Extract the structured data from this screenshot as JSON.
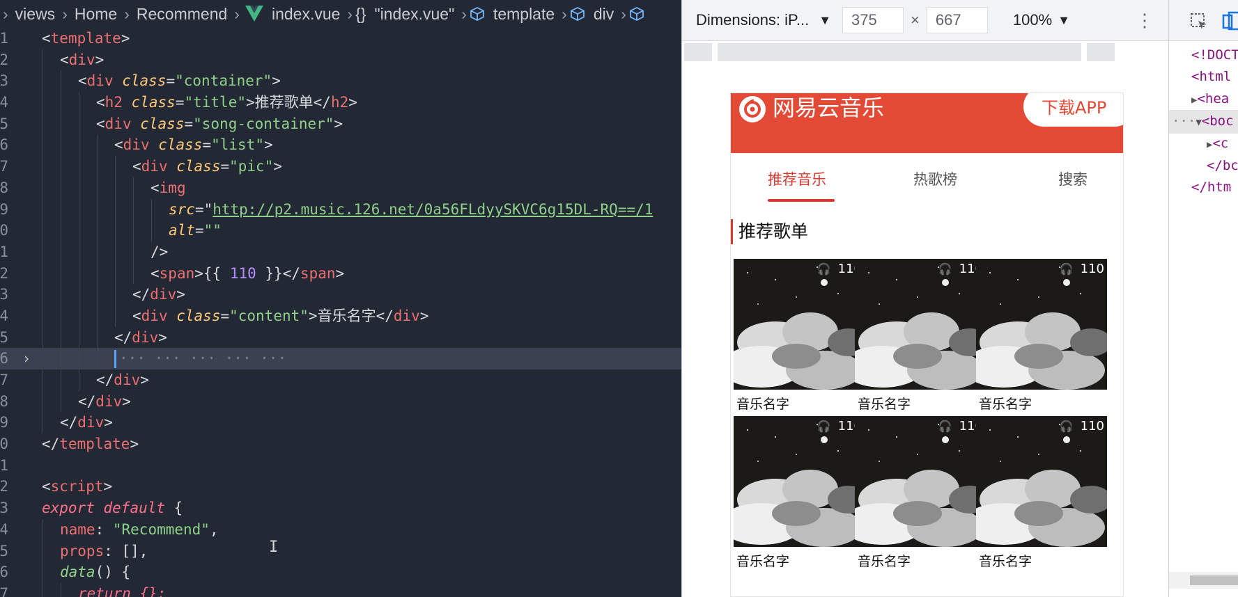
{
  "editor": {
    "breadcrumb": {
      "views": "views",
      "home": "Home",
      "recommend": "Recommend",
      "file": "index.vue",
      "braces": "{}",
      "component": "\"index.vue\"",
      "template": "template",
      "div": "div"
    },
    "line_numbers": [
      "1",
      "2",
      "3",
      "4",
      "5",
      "6",
      "7",
      "8",
      "9",
      "0",
      "1",
      "2",
      "3",
      "4",
      "5",
      "6",
      "7",
      "8",
      "9",
      "0",
      "1",
      "2",
      "3",
      "4",
      "5",
      "6",
      "7"
    ],
    "text": {
      "template": "template",
      "div": "div",
      "class": "class",
      "container": "\"container\"",
      "h2": "h2",
      "title_val": "\"title\"",
      "title_text": "推荐歌单",
      "song_container": "\"song-container\"",
      "list": "\"list\"",
      "pic": "\"pic\"",
      "img": "img",
      "src": "src",
      "src_url": "http://p2.music.126.net/0a56FLdyySKVC6g15DL-RQ==/1",
      "alt": "alt",
      "alt_val": "\"\"",
      "span": "span",
      "expr_open": "{{ ",
      "expr_num": "110",
      "expr_close": " }}",
      "content": "\"content\"",
      "content_text": "音乐名字",
      "folded": "··· ··· ··· ··· ···",
      "script": "script",
      "export": "export",
      "default": "default",
      "brace_open": " {",
      "name_key": "name",
      "name_val": "\"Recommend\"",
      "props_key": "props",
      "props_val": "[],",
      "data_fn": "data",
      "data_rest": "() {",
      "return_line": "return {};"
    }
  },
  "devtools": {
    "dimensions_label": "Dimensions: iP...",
    "width": "375",
    "times": "×",
    "height": "667",
    "zoom": "100%",
    "more": "⋮"
  },
  "app": {
    "brand": "网易云音乐",
    "download": "下载APP",
    "tabs": [
      "推荐音乐",
      "热歌榜",
      "搜索"
    ],
    "section_title": "推荐歌单",
    "play_count": "110",
    "song_name": "音乐名字",
    "colors": {
      "brand_red": "#e24a35",
      "accent_red": "#d33a31"
    }
  },
  "elements_panel": {
    "doctype": "<!DOCT",
    "html_open": "<html",
    "head": "<hea",
    "body": "<boc",
    "child": "<c",
    "body_close": "</bc",
    "html_close": "</htm"
  }
}
